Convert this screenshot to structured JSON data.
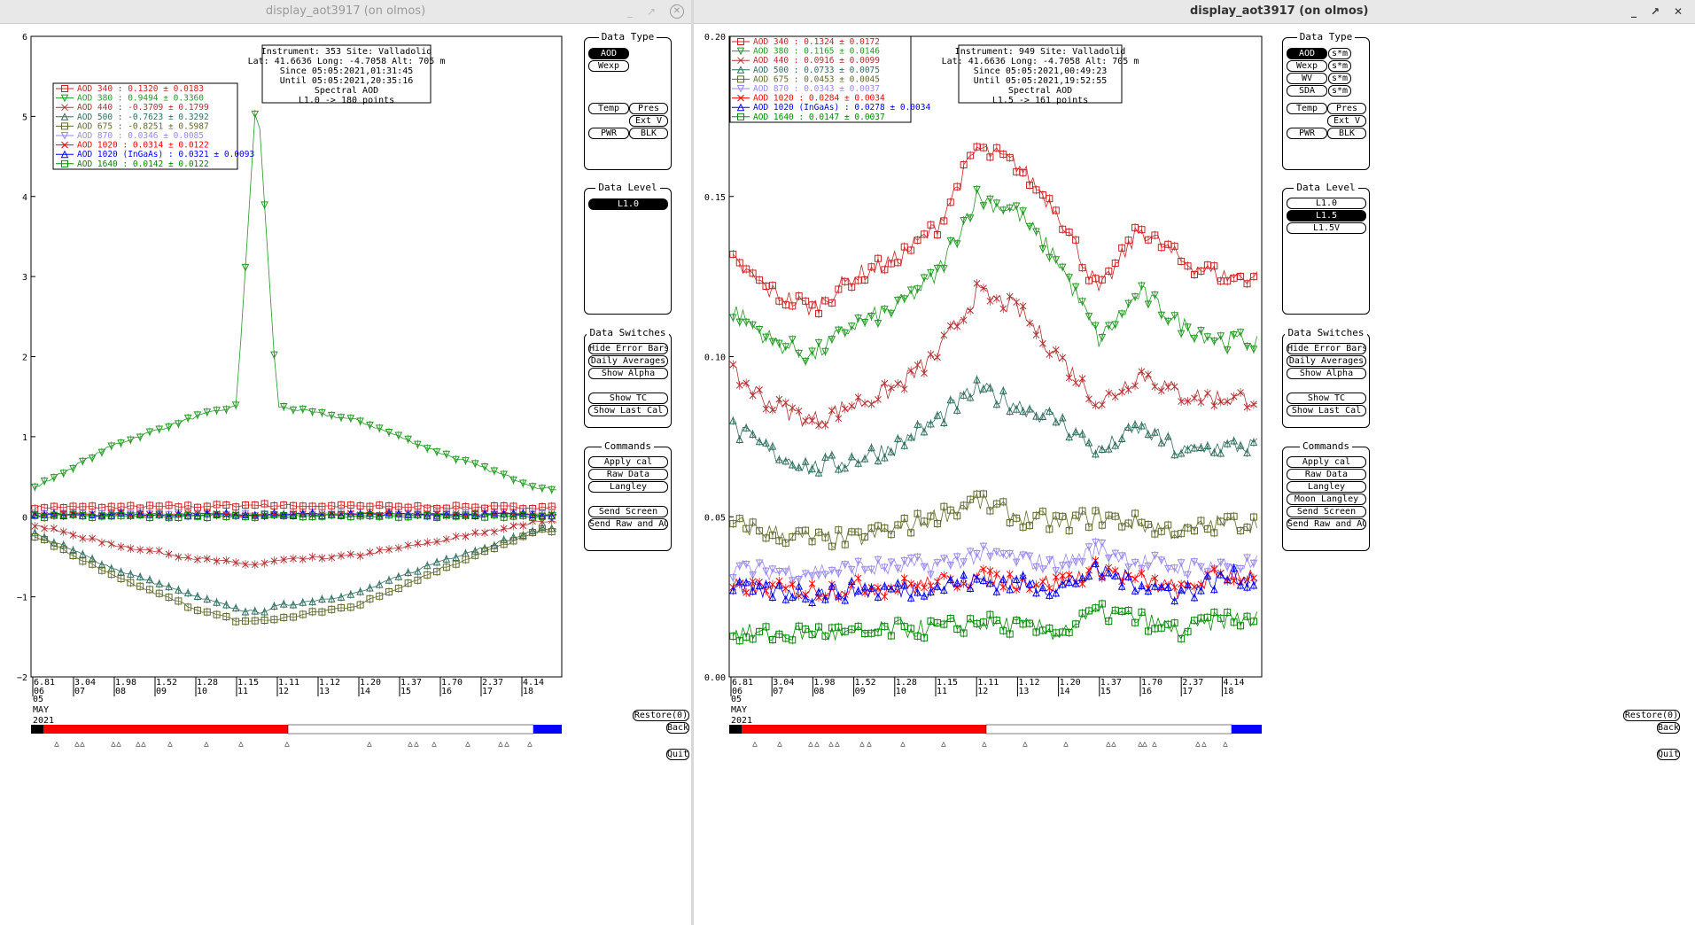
{
  "left": {
    "title": "display_aot3917 (on olmos)",
    "info": [
      "Instrument: 353 Site: Valladolid",
      "Lat: 41.6636 Long: -4.7058 Alt: 705 m",
      "Since 05:05:2021,01:31:45",
      "Until 05:05:2021,20:35:16",
      "Spectral AOD",
      "L1.0 -> 180 points"
    ],
    "legend": [
      {
        "label": "AOD 340   : 0.1320 ± 0.0183",
        "color": "#cc2222",
        "marker": "square"
      },
      {
        "label": "AOD 380   : 0.9494 ± 0.3360",
        "color": "#229922",
        "marker": "tridown"
      },
      {
        "label": "AOD 440   : -0.3709 ± 0.1799",
        "color": "#b03030",
        "marker": "x"
      },
      {
        "label": "AOD 500   : -0.7623 ± 0.3292",
        "color": "#2e6e5e",
        "marker": "triup"
      },
      {
        "label": "AOD 675   : -0.8251 ± 0.5987",
        "color": "#5e6a2a",
        "marker": "square"
      },
      {
        "label": "AOD 870   : 0.0346 ± 0.0085",
        "color": "#9988ee",
        "marker": "tridown"
      },
      {
        "label": "AOD 1020  : 0.0314 ± 0.0122",
        "color": "#ff0000",
        "marker": "x"
      },
      {
        "label": "AOD 1020 (InGaAs)  : 0.0321 ± 0.0093",
        "color": "#0000ff",
        "marker": "triup"
      },
      {
        "label": "AOD 1640  : 0.0142 ± 0.0122",
        "color": "#008800",
        "marker": "square"
      }
    ],
    "yticks": [
      "6",
      "5",
      "4",
      "3",
      "2",
      "1",
      "0",
      "−1",
      "−2"
    ],
    "xticks": [
      {
        "top": "6.81",
        "bot": "06"
      },
      {
        "top": "3.04",
        "bot": "07"
      },
      {
        "top": "1.98",
        "bot": "08"
      },
      {
        "top": "1.52",
        "bot": "09"
      },
      {
        "top": "1.28",
        "bot": "10"
      },
      {
        "top": "1.15",
        "bot": "11"
      },
      {
        "top": "1.11",
        "bot": "12"
      },
      {
        "top": "1.12",
        "bot": "13"
      },
      {
        "top": "1.20",
        "bot": "14"
      },
      {
        "top": "1.37",
        "bot": "15"
      },
      {
        "top": "1.70",
        "bot": "16"
      },
      {
        "top": "2.37",
        "bot": "17"
      },
      {
        "top": "4.14",
        "bot": "18"
      }
    ],
    "date": [
      "05",
      "MAY",
      "2021"
    ],
    "datatype": {
      "title": "Data Type",
      "aod": "AOD",
      "wexp": "Wexp",
      "temp": "Temp",
      "pres": "Pres",
      "extv": "Ext V",
      "pwr": "PWR",
      "blk": "BLK"
    },
    "datalevel": {
      "title": "Data Level",
      "l10": "L1.0"
    },
    "switches": {
      "title": "Data Switches",
      "items": [
        "Hide Error Bars",
        "Daily Averages",
        "Show Alpha",
        "Show TC",
        "Show Last Cal"
      ]
    },
    "commands": {
      "title": "Commands",
      "items": [
        "Apply cal",
        "Raw Data",
        "Langley",
        "Send Screen",
        "Send Raw and AOD"
      ]
    },
    "restore": "Restore(0)",
    "back": "Back",
    "quit": "Quit"
  },
  "right": {
    "title": "display_aot3917 (on olmos)",
    "info": [
      "Instrument: 949 Site: Valladolid",
      "Lat: 41.6636 Long: -4.7058 Alt: 705 m",
      "Since 05:05:2021,00:49:23",
      "Until 05:05:2021,19:52:55",
      "Spectral AOD",
      "L1.5 -> 161 points"
    ],
    "legend": [
      {
        "label": "AOD 340   : 0.1324 ± 0.0172",
        "color": "#cc2222",
        "marker": "square"
      },
      {
        "label": "AOD 380   : 0.1165 ± 0.0146",
        "color": "#229922",
        "marker": "tridown"
      },
      {
        "label": "AOD 440   : 0.0916 ± 0.0099",
        "color": "#b03030",
        "marker": "x"
      },
      {
        "label": "AOD 500   : 0.0733 ± 0.0075",
        "color": "#2e6e5e",
        "marker": "triup"
      },
      {
        "label": "AOD 675   : 0.0453 ± 0.0045",
        "color": "#5e6a2a",
        "marker": "square"
      },
      {
        "label": "AOD 870   : 0.0343 ± 0.0037",
        "color": "#9988ee",
        "marker": "tridown"
      },
      {
        "label": "AOD 1020  : 0.0284 ± 0.0034",
        "color": "#ff0000",
        "marker": "x"
      },
      {
        "label": "AOD 1020 (InGaAs)  : 0.0278 ± 0.0034",
        "color": "#0000ff",
        "marker": "triup"
      },
      {
        "label": "AOD 1640  : 0.0147 ± 0.0037",
        "color": "#008800",
        "marker": "square"
      }
    ],
    "yticks": [
      "0.20",
      "0.15",
      "0.10",
      "0.05",
      "0.00"
    ],
    "xticks": [
      {
        "top": "6.81",
        "bot": "06"
      },
      {
        "top": "3.04",
        "bot": "07"
      },
      {
        "top": "1.98",
        "bot": "08"
      },
      {
        "top": "1.52",
        "bot": "09"
      },
      {
        "top": "1.28",
        "bot": "10"
      },
      {
        "top": "1.15",
        "bot": "11"
      },
      {
        "top": "1.11",
        "bot": "12"
      },
      {
        "top": "1.12",
        "bot": "13"
      },
      {
        "top": "1.20",
        "bot": "14"
      },
      {
        "top": "1.37",
        "bot": "15"
      },
      {
        "top": "1.70",
        "bot": "16"
      },
      {
        "top": "2.37",
        "bot": "17"
      },
      {
        "top": "4.14",
        "bot": "18"
      }
    ],
    "date": [
      "05",
      "MAY",
      "2021"
    ],
    "datatype": {
      "title": "Data Type",
      "aod": "AOD",
      "wexp": "Wexp",
      "wv": "WV",
      "sda": "SDA",
      "sm": "s*m",
      "temp": "Temp",
      "pres": "Pres",
      "extv": "Ext V",
      "pwr": "PWR",
      "blk": "BLK"
    },
    "datalevel": {
      "title": "Data Level",
      "l10": "L1.0",
      "l15": "L1.5",
      "l15v": "L1.5V"
    },
    "switches": {
      "title": "Data Switches",
      "items": [
        "Hide Error Bars",
        "Daily Averages",
        "Show Alpha",
        "Show TC",
        "Show Last Cal"
      ]
    },
    "commands": {
      "title": "Commands",
      "items": [
        "Apply cal",
        "Raw Data",
        "Langley",
        "Moon Langley",
        "Send Screen",
        "Send Raw and AOD"
      ]
    },
    "restore": "Restore(0)",
    "back": "Back",
    "quit": "Quit"
  },
  "chart_data": [
    {
      "type": "line",
      "title": "Spectral AOD",
      "xlabel": "",
      "ylabel": "",
      "ylim": [
        -2,
        6
      ],
      "x_note": "airmass ticks; hours 06-18 UTC, 05 MAY 2021",
      "x_hours": [
        6,
        8,
        10,
        11,
        11.5,
        12,
        14,
        16,
        18.5
      ],
      "series": [
        {
          "name": "AOD 340",
          "values": [
            0.12,
            0.12,
            0.13,
            0.14,
            0.15,
            0.14,
            0.13,
            0.12,
            0.12
          ]
        },
        {
          "name": "AOD 380",
          "values": [
            0.35,
            0.9,
            1.25,
            1.38,
            5.4,
            1.38,
            1.2,
            0.8,
            0.35
          ]
        },
        {
          "name": "AOD 440",
          "values": [
            -0.1,
            -0.35,
            -0.52,
            -0.58,
            -0.6,
            -0.55,
            -0.48,
            -0.3,
            -0.05
          ]
        },
        {
          "name": "AOD 500",
          "values": [
            -0.2,
            -0.65,
            -1.0,
            -1.15,
            -1.2,
            -1.12,
            -0.95,
            -0.55,
            -0.15
          ]
        },
        {
          "name": "AOD 675",
          "values": [
            -0.22,
            -0.75,
            -1.15,
            -1.3,
            -1.3,
            -1.28,
            -1.1,
            -0.65,
            -0.17
          ]
        },
        {
          "name": "AOD 870",
          "values": [
            0.03,
            0.03,
            0.03,
            0.03,
            0.03,
            0.03,
            0.03,
            0.03,
            0.03
          ]
        },
        {
          "name": "AOD 1020",
          "values": [
            0.03,
            0.03,
            0.03,
            0.03,
            0.03,
            0.03,
            0.03,
            0.03,
            0.03
          ]
        },
        {
          "name": "AOD 1020 (InGaAs)",
          "values": [
            0.03,
            0.03,
            0.03,
            0.03,
            0.03,
            0.03,
            0.03,
            0.03,
            0.03
          ]
        },
        {
          "name": "AOD 1640",
          "values": [
            0.01,
            0.01,
            0.01,
            0.01,
            0.01,
            0.01,
            0.01,
            0.01,
            0.01
          ]
        }
      ]
    },
    {
      "type": "line",
      "title": "Spectral AOD",
      "xlabel": "",
      "ylabel": "",
      "ylim": [
        0,
        0.2
      ],
      "x_note": "airmass ticks; hours 06-18 UTC, 05 MAY 2021",
      "x_hours": [
        6,
        7,
        8,
        9,
        10,
        11,
        12,
        13,
        14,
        15,
        16,
        17,
        18
      ],
      "series": [
        {
          "name": "AOD 340",
          "values": [
            0.13,
            0.12,
            0.115,
            0.125,
            0.13,
            0.14,
            0.165,
            0.16,
            0.145,
            0.12,
            0.14,
            0.13,
            0.125
          ]
        },
        {
          "name": "AOD 380",
          "values": [
            0.115,
            0.105,
            0.1,
            0.11,
            0.115,
            0.125,
            0.15,
            0.145,
            0.13,
            0.105,
            0.12,
            0.11,
            0.105
          ]
        },
        {
          "name": "AOD 440",
          "values": [
            0.095,
            0.085,
            0.08,
            0.085,
            0.09,
            0.1,
            0.12,
            0.115,
            0.1,
            0.085,
            0.095,
            0.088,
            0.087
          ]
        },
        {
          "name": "AOD 500",
          "values": [
            0.078,
            0.07,
            0.065,
            0.068,
            0.072,
            0.08,
            0.09,
            0.085,
            0.08,
            0.07,
            0.078,
            0.07,
            0.072
          ]
        },
        {
          "name": "AOD 675",
          "values": [
            0.048,
            0.045,
            0.043,
            0.043,
            0.046,
            0.05,
            0.055,
            0.05,
            0.048,
            0.05,
            0.048,
            0.045,
            0.048
          ]
        },
        {
          "name": "AOD 870",
          "values": [
            0.034,
            0.033,
            0.033,
            0.034,
            0.034,
            0.035,
            0.038,
            0.037,
            0.035,
            0.04,
            0.036,
            0.034,
            0.035
          ]
        },
        {
          "name": "AOD 1020",
          "values": [
            0.028,
            0.027,
            0.027,
            0.028,
            0.028,
            0.029,
            0.031,
            0.03,
            0.029,
            0.034,
            0.03,
            0.027,
            0.032
          ]
        },
        {
          "name": "AOD 1020 (InGaAs)",
          "values": [
            0.027,
            0.027,
            0.026,
            0.027,
            0.027,
            0.028,
            0.03,
            0.029,
            0.028,
            0.033,
            0.029,
            0.026,
            0.031
          ]
        },
        {
          "name": "AOD 1640",
          "values": [
            0.014,
            0.013,
            0.014,
            0.013,
            0.015,
            0.015,
            0.017,
            0.016,
            0.014,
            0.02,
            0.018,
            0.014,
            0.018
          ]
        }
      ]
    }
  ]
}
